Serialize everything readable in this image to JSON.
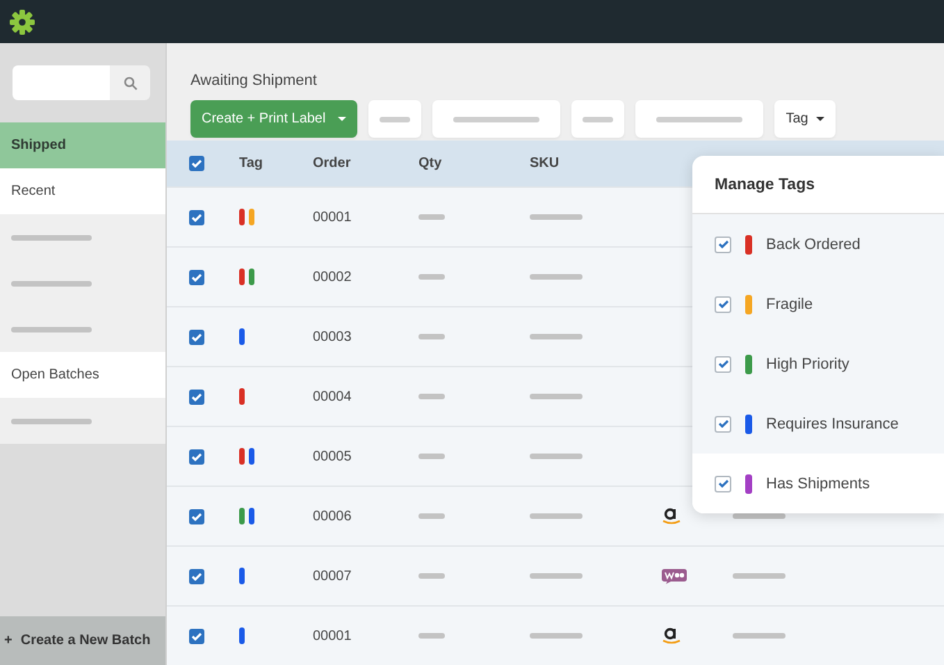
{
  "sidebar": {
    "items": [
      {
        "kind": "label",
        "label": "Shipped",
        "selected": true
      },
      {
        "kind": "label",
        "label": "Recent",
        "selected": false
      },
      {
        "kind": "blank"
      },
      {
        "kind": "blank"
      },
      {
        "kind": "blank"
      },
      {
        "kind": "label",
        "label": "Open Batches",
        "selected": false
      },
      {
        "kind": "blank"
      }
    ],
    "create_batch": {
      "icon": "+",
      "label": "Create a New Batch"
    }
  },
  "main": {
    "title": "Awaiting Shipment",
    "toolbar": [
      {
        "kind": "primary",
        "label": "Create + Print Label"
      },
      {
        "kind": "short_blank"
      },
      {
        "kind": "long_blank"
      },
      {
        "kind": "short_blank"
      },
      {
        "kind": "long_blank"
      },
      {
        "kind": "dropdown",
        "label": "Tag"
      }
    ],
    "table": {
      "header_checked": true,
      "columns": [
        "Tag",
        "Order",
        "Qty",
        "SKU"
      ],
      "rows": [
        {
          "checked": true,
          "tags": [
            {
              "color": "#d93025"
            },
            {
              "color": "#f5a623"
            }
          ],
          "order": "00001"
        },
        {
          "checked": true,
          "tags": [
            {
              "color": "#d93025"
            },
            {
              "color": "#3c9a4a"
            }
          ],
          "order": "00002"
        },
        {
          "checked": true,
          "tags": [
            {
              "color": "#1a5ae8"
            }
          ],
          "order": "00003"
        },
        {
          "checked": true,
          "tags": [
            {
              "color": "#d93025"
            }
          ],
          "order": "00004"
        },
        {
          "checked": true,
          "tags": [
            {
              "color": "#d93025"
            },
            {
              "color": "#1a5ae8"
            }
          ],
          "order": "00005"
        },
        {
          "checked": true,
          "tags": [
            {
              "color": "#3c9a4a"
            },
            {
              "color": "#1a5ae8"
            }
          ],
          "order": "00006",
          "kind": "amazon"
        },
        {
          "checked": true,
          "tags": [
            {
              "color": "#1a5ae8"
            }
          ],
          "order": "00007",
          "kind": "woo"
        },
        {
          "checked": true,
          "tags": [
            {
              "color": "#1a5ae8"
            }
          ],
          "order": "00001",
          "kind": "amazon"
        }
      ]
    }
  },
  "manage_tags": {
    "title": "Manage Tags",
    "items": [
      {
        "label": "Back Ordered",
        "color": "#d93025",
        "checked": true,
        "hovered": false
      },
      {
        "label": "Fragile",
        "color": "#f5a623",
        "checked": true,
        "hovered": false
      },
      {
        "label": "High Priority",
        "color": "#3c9a4a",
        "checked": true,
        "hovered": false
      },
      {
        "label": "Requires Insurance",
        "color": "#1a5ae8",
        "checked": true,
        "hovered": false
      },
      {
        "label": "Has Shipments",
        "color": "#a33fc4",
        "checked": true,
        "hovered": true
      }
    ]
  }
}
